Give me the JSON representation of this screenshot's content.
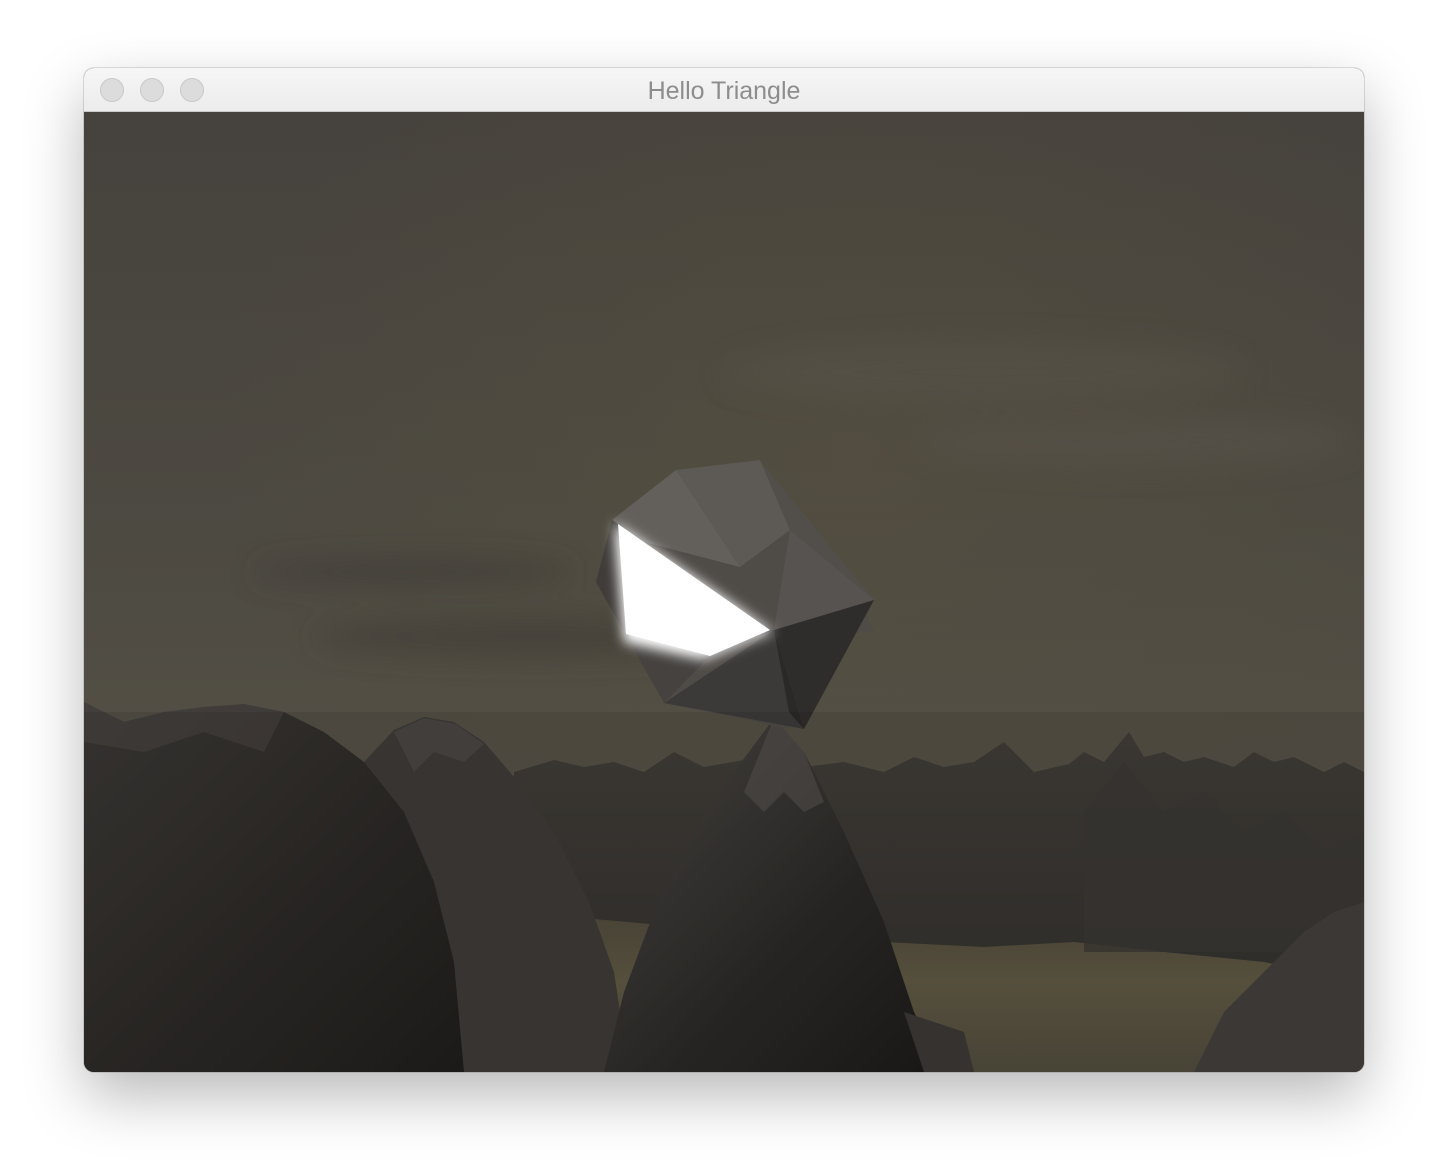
{
  "window": {
    "title": "Hello Triangle",
    "buttons": {
      "close": "close",
      "minimize": "minimize",
      "zoom": "zoom"
    }
  },
  "scene": {
    "sky_color": "#4a4740",
    "mountain_color": "#2e2b28",
    "water_color": "#5a5442",
    "icosahedron_color": "#5e5a55",
    "highlight_color": "#ffffff"
  }
}
